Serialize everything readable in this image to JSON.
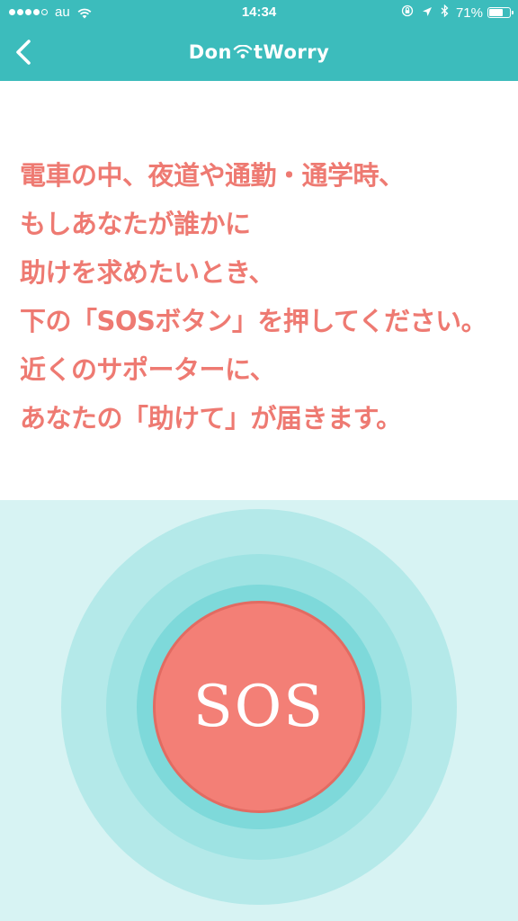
{
  "status_bar": {
    "carrier": "au",
    "signal_filled": 4,
    "signal_total": 5,
    "time": "14:34",
    "battery": "71%",
    "battery_level": 0.71
  },
  "header": {
    "logo_left": "Don",
    "logo_right": "tWorry",
    "logo_icon": "wifi-icon",
    "back_icon": "chevron-left-icon",
    "background_color": "#3cbcbc"
  },
  "message": {
    "lines": [
      "電車の中、夜道や通勤・通学時、",
      "もしあなたが誰かに",
      "助けを求めたいとき、",
      "下の「SOSボタン」を押してください。",
      "近くのサポーターに、",
      "あなたの「助けて」が届きます。"
    ],
    "color": "#ee7a72"
  },
  "sos": {
    "label": "SOS",
    "button_color": "#f37f76",
    "area_color": "#d7f3f3"
  }
}
